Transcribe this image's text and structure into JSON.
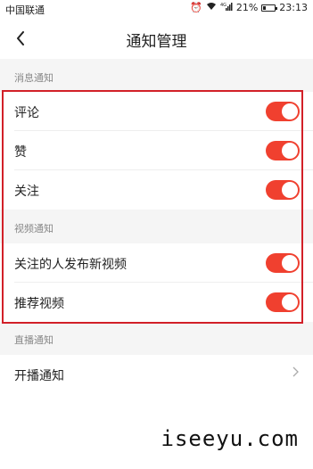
{
  "status_bar": {
    "carrier": "中国联通",
    "alarm_icon": "alarm-icon",
    "wifi_icon": "wifi-icon",
    "signal_text": "4G",
    "battery_percent": "21%",
    "battery_level": 0.21,
    "time": "23:13"
  },
  "nav": {
    "back_icon": "back-arrow-icon",
    "title": "通知管理"
  },
  "sections": {
    "message": {
      "header": "消息通知",
      "items": [
        {
          "label": "评论",
          "enabled": true
        },
        {
          "label": "赞",
          "enabled": true
        },
        {
          "label": "关注",
          "enabled": true
        }
      ]
    },
    "video": {
      "header": "视频通知",
      "items": [
        {
          "label": "关注的人发布新视频",
          "enabled": true
        },
        {
          "label": "推荐视频",
          "enabled": true
        }
      ]
    },
    "live": {
      "header": "直播通知",
      "items": [
        {
          "label": "开播通知",
          "chevron": "chevron-right-icon"
        }
      ]
    }
  },
  "colors": {
    "toggle_on": "#f0402f",
    "highlight": "#d22028",
    "background": "#f5f5f5"
  },
  "watermark": "iseeyu.com"
}
